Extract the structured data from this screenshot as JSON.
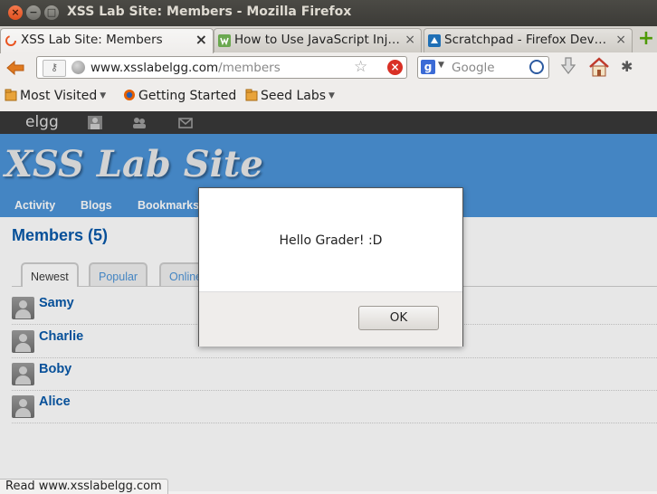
{
  "window": {
    "title": "XSS Lab Site: Members - Mozilla Firefox",
    "controls": [
      "×",
      "−",
      "□"
    ]
  },
  "tabs": [
    {
      "label": "XSS Lab Site: Members",
      "active": true
    },
    {
      "label": "How to Use JavaScript Inj…",
      "active": false
    },
    {
      "label": "Scratchpad - Firefox Dev…",
      "active": false
    }
  ],
  "tab_close_glyph": "×",
  "new_tab_glyph": "+",
  "nav": {
    "url_host": "www.xsslabelgg.com",
    "url_path": "/members",
    "search_placeholder": "Google"
  },
  "bookmarks": [
    "Most Visited",
    "Getting Started",
    "Seed Labs"
  ],
  "elgg": {
    "logo": "elgg",
    "site_title": "XSS Lab Site",
    "menu": [
      "Activity",
      "Blogs",
      "Bookmarks"
    ]
  },
  "content": {
    "title": "Members (5)",
    "tabs": [
      "Newest",
      "Popular",
      "Online"
    ],
    "members": [
      "Samy",
      "Charlie",
      "Boby",
      "Alice"
    ]
  },
  "dialog": {
    "message": "Hello Grader! :D",
    "ok_label": "OK"
  },
  "status_text": "Read www.xsslabelgg.com",
  "colors": {
    "header_blue": "#4690d6",
    "link_blue": "#0054a7",
    "topbar": "#333333"
  }
}
